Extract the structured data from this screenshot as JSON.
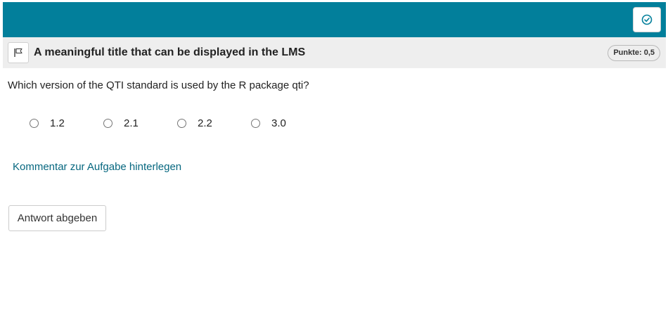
{
  "header": {
    "accent_color": "#027f9b",
    "end_button_icon": "check-circle-icon"
  },
  "item": {
    "flag_icon": "flag-icon",
    "title": "A meaningful title that can be displayed in the LMS",
    "points": "Punkte: 0,5",
    "question": "Which version of the QTI standard is used by the R package qti?",
    "options": [
      {
        "label": "1.2",
        "selected": false
      },
      {
        "label": "2.1",
        "selected": false
      },
      {
        "label": "2.2",
        "selected": false
      },
      {
        "label": "3.0",
        "selected": false
      }
    ],
    "comment_link": "Kommentar zur Aufgabe hinterlegen",
    "submit_label": "Antwort abgeben"
  }
}
